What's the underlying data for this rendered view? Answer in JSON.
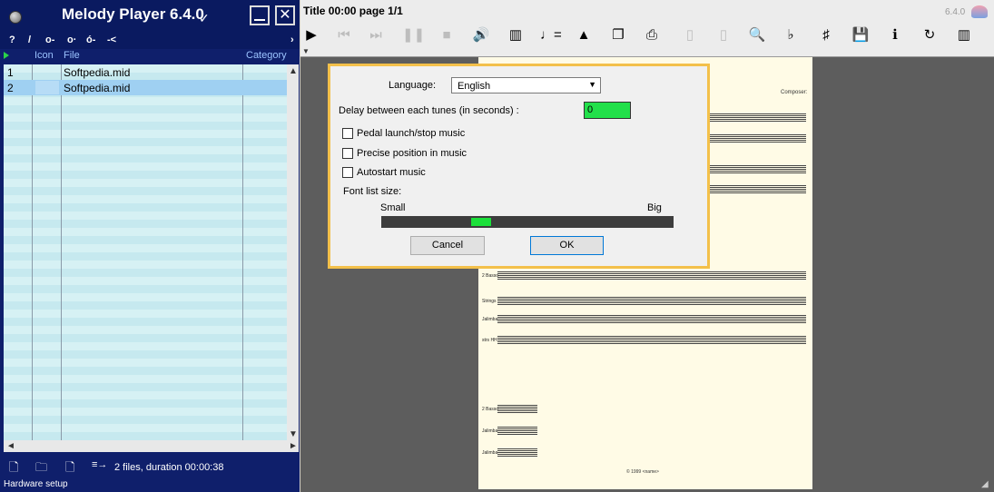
{
  "app": {
    "title": "Melody Player 6.4.0",
    "check_glyph": "✓",
    "minimize_icon": "minimize-icon",
    "close_glyph": "✕",
    "tool_icons": [
      "?",
      "/",
      "o-",
      "o·",
      "ó-",
      "-<"
    ],
    "tool_chevron": "›"
  },
  "playlist": {
    "columns": [
      "Icon",
      "File",
      "Category"
    ],
    "rows": [
      {
        "num": "1",
        "file": "Softpedia.mid",
        "selected": false
      },
      {
        "num": "2",
        "file": "Softpedia.mid",
        "selected": true
      }
    ],
    "scroll_up": "▲",
    "scroll_down": "▼",
    "scroll_left": "◄",
    "scroll_right": "►"
  },
  "footer": {
    "icons": [
      "add-file-icon",
      "add-folder-icon",
      "remove-file-icon",
      "sort-icon"
    ],
    "icon_glyphs": [
      "🗋",
      "🗀",
      "🗋",
      "≡→"
    ],
    "info": "2 files, duration 00:00:38",
    "status": "Hardware setup"
  },
  "document": {
    "title": "Title 00:00 page 1/1",
    "version": "6.4.0",
    "composer": "Composer:",
    "copyright": "© 1999 <name>",
    "instruments": [
      "2 Basso",
      "Strings",
      "Jalimba",
      "strs HH",
      "2 Basso",
      "Jalimba",
      "Jalimba"
    ]
  },
  "toolbar": {
    "buttons": [
      {
        "name": "play-button",
        "glyph": "▶",
        "dim": false
      },
      {
        "name": "previous-button",
        "glyph": "⏮",
        "dim": true
      },
      {
        "name": "next-button",
        "glyph": "⏭",
        "dim": true
      },
      {
        "name": "pause-button",
        "glyph": "❚❚",
        "dim": true
      },
      {
        "name": "stop-button",
        "glyph": "■",
        "dim": true
      },
      {
        "name": "volume-button",
        "glyph": "🔊",
        "dim": false
      },
      {
        "name": "mixer-button",
        "glyph": "▥",
        "dim": false
      },
      {
        "name": "tempo-button",
        "glyph": "♩=",
        "dim": false
      },
      {
        "name": "metronome-button",
        "glyph": "▲",
        "dim": false
      },
      {
        "name": "copy-button",
        "glyph": "❐",
        "dim": false
      },
      {
        "name": "print-button",
        "glyph": "⎙",
        "dim": false
      },
      {
        "name": "page-prev-button",
        "glyph": "▯",
        "dim": true
      },
      {
        "name": "page-next-button",
        "glyph": "▯",
        "dim": true
      },
      {
        "name": "zoom-button",
        "glyph": "🔍",
        "dim": false
      },
      {
        "name": "flat-key-button",
        "glyph": "♭",
        "dim": false
      },
      {
        "name": "transpose-button",
        "glyph": "♯",
        "dim": false
      },
      {
        "name": "save-button",
        "glyph": "💾",
        "dim": false
      },
      {
        "name": "info-button",
        "glyph": "ℹ",
        "dim": false
      },
      {
        "name": "refresh-button",
        "glyph": "↻",
        "dim": false
      },
      {
        "name": "piano-button",
        "glyph": "▥",
        "dim": false
      }
    ]
  },
  "dialog": {
    "language_label": "Language:",
    "language_value": "English",
    "language_chevron": "▼",
    "delay_label": "Delay between each tunes (in seconds) :",
    "delay_value": "0",
    "options": [
      "Pedal launch/stop music",
      "Precise position in music",
      "Autostart music"
    ],
    "font_size_label": "Font list size:",
    "small_label": "Small",
    "big_label": "Big",
    "font_size_level": 0.33,
    "cancel_label": "Cancel",
    "ok_label": "OK"
  },
  "colors": {
    "panel_bg": "#0f1f6b",
    "list_row_a": "#d6f1f4",
    "list_row_b": "#c6e9ef",
    "selected_row": "#9fd0f2",
    "dialog_border": "#f3c04a",
    "input_green": "#22e04a",
    "slider_track": "#3d3d3d",
    "slider_thumb": "#1be03a"
  }
}
